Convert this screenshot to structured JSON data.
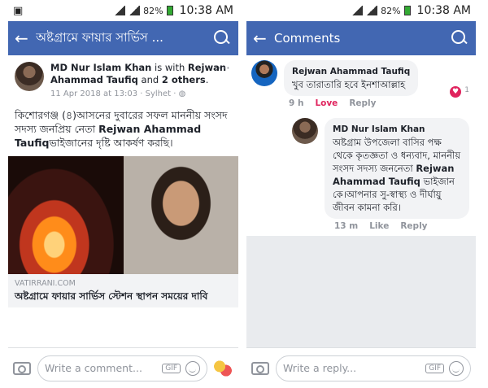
{
  "status": {
    "battery": "82%",
    "time": "10:38 AM"
  },
  "left": {
    "header_title": "অষ্টগ্রামে ফায়ার সার্ভিস ...",
    "post": {
      "author": "MD Nur Islam Khan",
      "with_text": " is with ",
      "tagged": "Rejwan Ahammad Taufiq",
      "and_text": " and ",
      "others": "2 others",
      "period": ".",
      "meta": "11 Apr 2018 at 13:03 · Sylhet ·",
      "body_1": "কিশোরগঞ্জ (৪)আসনের দুবারের সফল মাননীয় সংসদ সদস্য জনপ্রিয় নেতা ",
      "body_bold": "Rejwan Ahammad Taufiq",
      "body_2": "ভাইজানের দৃষ্টি আকর্ষণ করছি।",
      "link_domain": "VATIRRANI.COM",
      "link_title": "অষ্টগ্রামে ফায়ার সার্ভিস স্টেশন স্থাপন সময়ের দাবি"
    },
    "composer_placeholder": "Write a comment...",
    "gif": "GIF"
  },
  "right": {
    "header_title": "Comments",
    "comment1": {
      "name": "Rejwan Ahammad Taufiq",
      "text": "খুব তারাতারি হবে ইনশাআল্লাহ",
      "time": "9 h",
      "love": "Love",
      "reply": "Reply",
      "count": "1"
    },
    "comment2": {
      "name": "MD Nur Islam Khan",
      "text_1": "অষ্টগ্রাম উপজেলা বাসির পক্ষ থেকে কৃতজ্ঞতা ও ধন্যবাদ, মাননীয় সংসদ সদস্য জননেতা ",
      "text_bold": "Rejwan Ahammad Taufiq",
      "text_2": " ভাইজান কে।আপনার সু-স্বাস্থ্য ও দীর্ঘায়ু জীবন কামনা করি।",
      "time": "13 m",
      "like": "Like",
      "reply": "Reply"
    },
    "composer_placeholder": "Write a reply...",
    "gif": "GIF"
  }
}
